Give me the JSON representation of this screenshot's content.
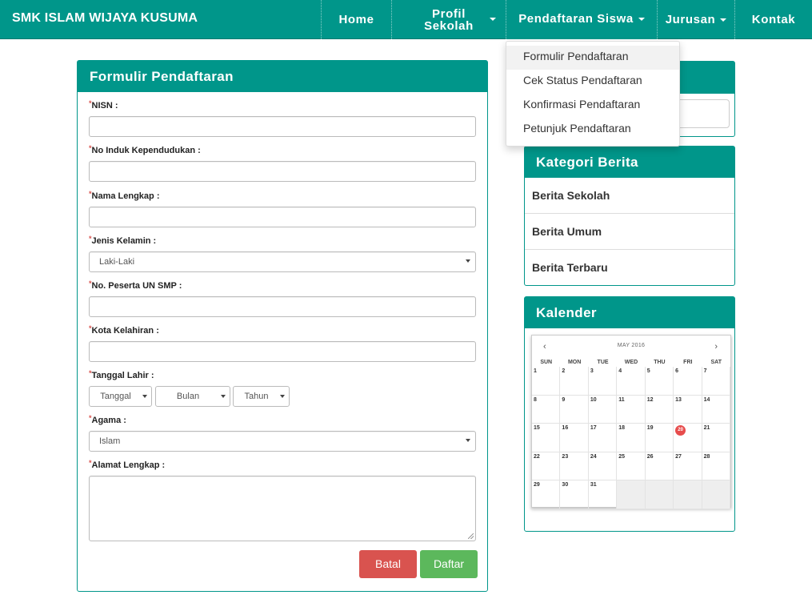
{
  "brand": "SMK ISLAM WIJAYA KUSUMA",
  "nav": {
    "home": "Home",
    "profil": "Profil Sekolah",
    "pendaftaran": "Pendaftaran Siswa",
    "jurusan": "Jurusan",
    "kontak": "Kontak"
  },
  "dropdown": {
    "items": [
      "Formulir Pendaftaran",
      "Cek Status Pendaftaran",
      "Konfirmasi Pendaftaran",
      "Petunjuk Pendaftaran"
    ]
  },
  "form": {
    "title": "Formulir Pendaftaran",
    "required_mark": "*",
    "labels": {
      "nisn": "NISN :",
      "nik": "No Induk Kependudukan :",
      "nama": "Nama Lengkap :",
      "jk": "Jenis Kelamin :",
      "un": "No. Peserta UN SMP :",
      "kota": "Kota Kelahiran :",
      "tgl": "Tanggal Lahir :",
      "agama": "Agama :",
      "alamat": "Alamat Lengkap :"
    },
    "values": {
      "jk": "Laki-Laki",
      "tanggal": "Tanggal",
      "bulan": "Bulan",
      "tahun": "Tahun",
      "agama": "Islam"
    },
    "buttons": {
      "batal": "Batal",
      "daftar": "Daftar"
    }
  },
  "kategori": {
    "title": "Kategori Berita",
    "items": [
      "Berita Sekolah",
      "Berita Umum",
      "Berita Terbaru"
    ]
  },
  "kalender": {
    "title": "Kalender",
    "month": "MAY 2016",
    "prev": "‹",
    "next": "›",
    "dow": [
      "SUN",
      "MON",
      "TUE",
      "WED",
      "THU",
      "FRI",
      "SAT"
    ],
    "days": [
      "1",
      "2",
      "3",
      "4",
      "5",
      "6",
      "7",
      "8",
      "9",
      "10",
      "11",
      "12",
      "13",
      "14",
      "15",
      "16",
      "17",
      "18",
      "19",
      "20",
      "21",
      "22",
      "23",
      "24",
      "25",
      "26",
      "27",
      "28",
      "29",
      "30",
      "31",
      "",
      "",
      "",
      ""
    ],
    "today": "20"
  },
  "colors": {
    "primary": "#00968a",
    "danger": "#d9534f",
    "success": "#5cb85c",
    "today": "#e74c4c"
  }
}
